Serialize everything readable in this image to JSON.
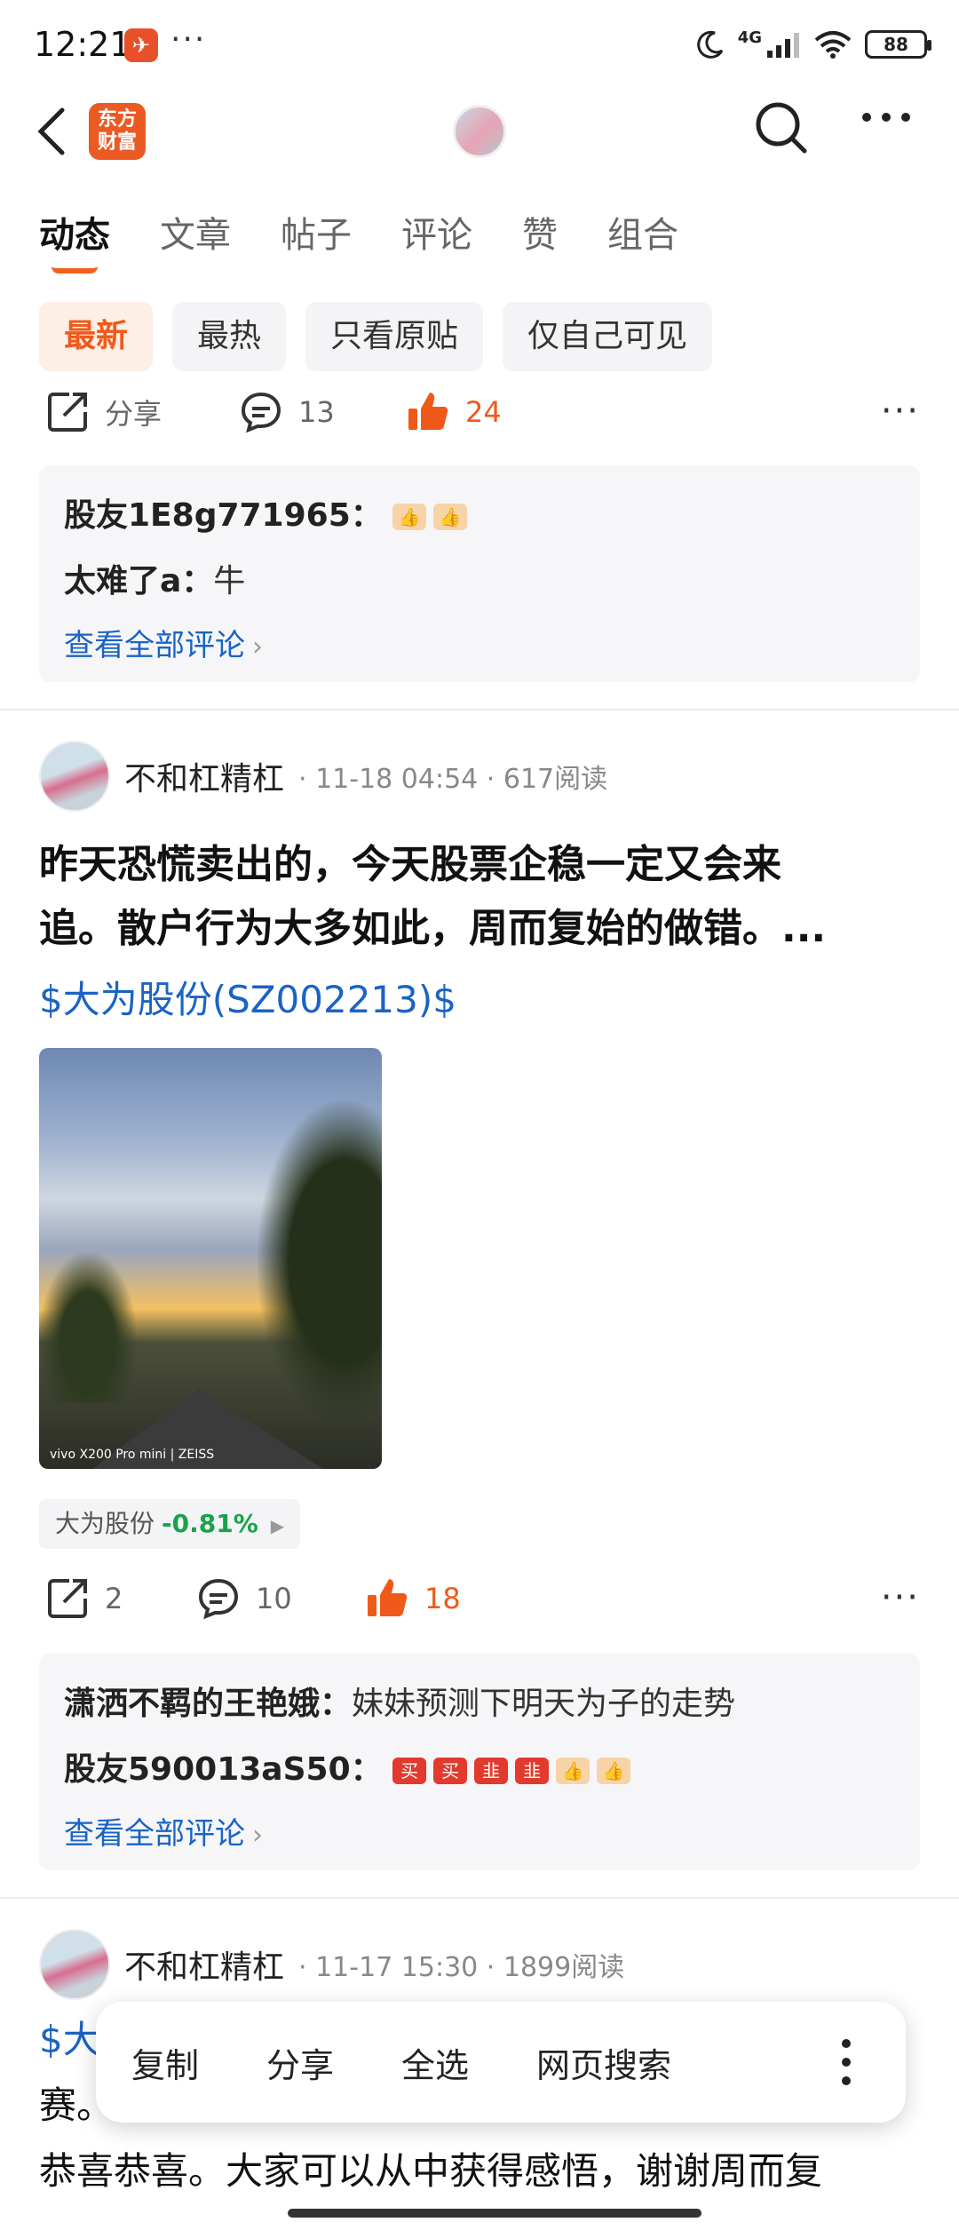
{
  "status": {
    "time": "12:21",
    "network": "4G",
    "battery": "88"
  },
  "nav": {
    "logo_line1": "东方",
    "logo_line2": "财富"
  },
  "tabs": [
    "动态",
    "文章",
    "帖子",
    "评论",
    "赞",
    "组合"
  ],
  "filters": [
    "最新",
    "最热",
    "只看原贴",
    "仅自己可见"
  ],
  "post1": {
    "share_label": "分享",
    "comments": "13",
    "likes": "24",
    "comment_list": [
      {
        "author": "股友1E8g771965：",
        "text": ""
      },
      {
        "author": "太难了a：",
        "text": "牛"
      }
    ],
    "view_all": "查看全部评论"
  },
  "post2": {
    "author": "不和杠精杠",
    "time": "11-18 04:54",
    "reads": "617阅读",
    "title_line1": "昨天恐慌卖出的，今天股票企稳一定又会来",
    "title_line2": "追。散户行为大多如此，周而复始的做错。...",
    "stock_tag": "$大为股份(SZ002213)$",
    "image_watermark": "vivo X200 Pro mini | ZEISS",
    "stock_name": "大为股份",
    "stock_change": "-0.81%",
    "shares": "2",
    "comments": "10",
    "likes": "18",
    "comment_list": [
      {
        "author": "潇洒不羁的王艳娥：",
        "text": "妹妹预测下明天为子的走势"
      },
      {
        "author": "股友590013aS50：",
        "text": ""
      }
    ],
    "emoji_text_1": "买",
    "emoji_text_2": "买",
    "emoji_text_3": "韭",
    "emoji_text_4": "韭",
    "view_all": "查看全部评论"
  },
  "post3": {
    "author": "不和杠精杠",
    "time": "11-17 15:30",
    "reads": "1899阅读",
    "line1_prefix": "$大",
    "line2": "赛。",
    "line3": "恭喜恭喜。大家可以从中获得感悟，谢谢周而复"
  },
  "popup": {
    "items": [
      "复制",
      "分享",
      "全选",
      "网页搜索"
    ]
  }
}
